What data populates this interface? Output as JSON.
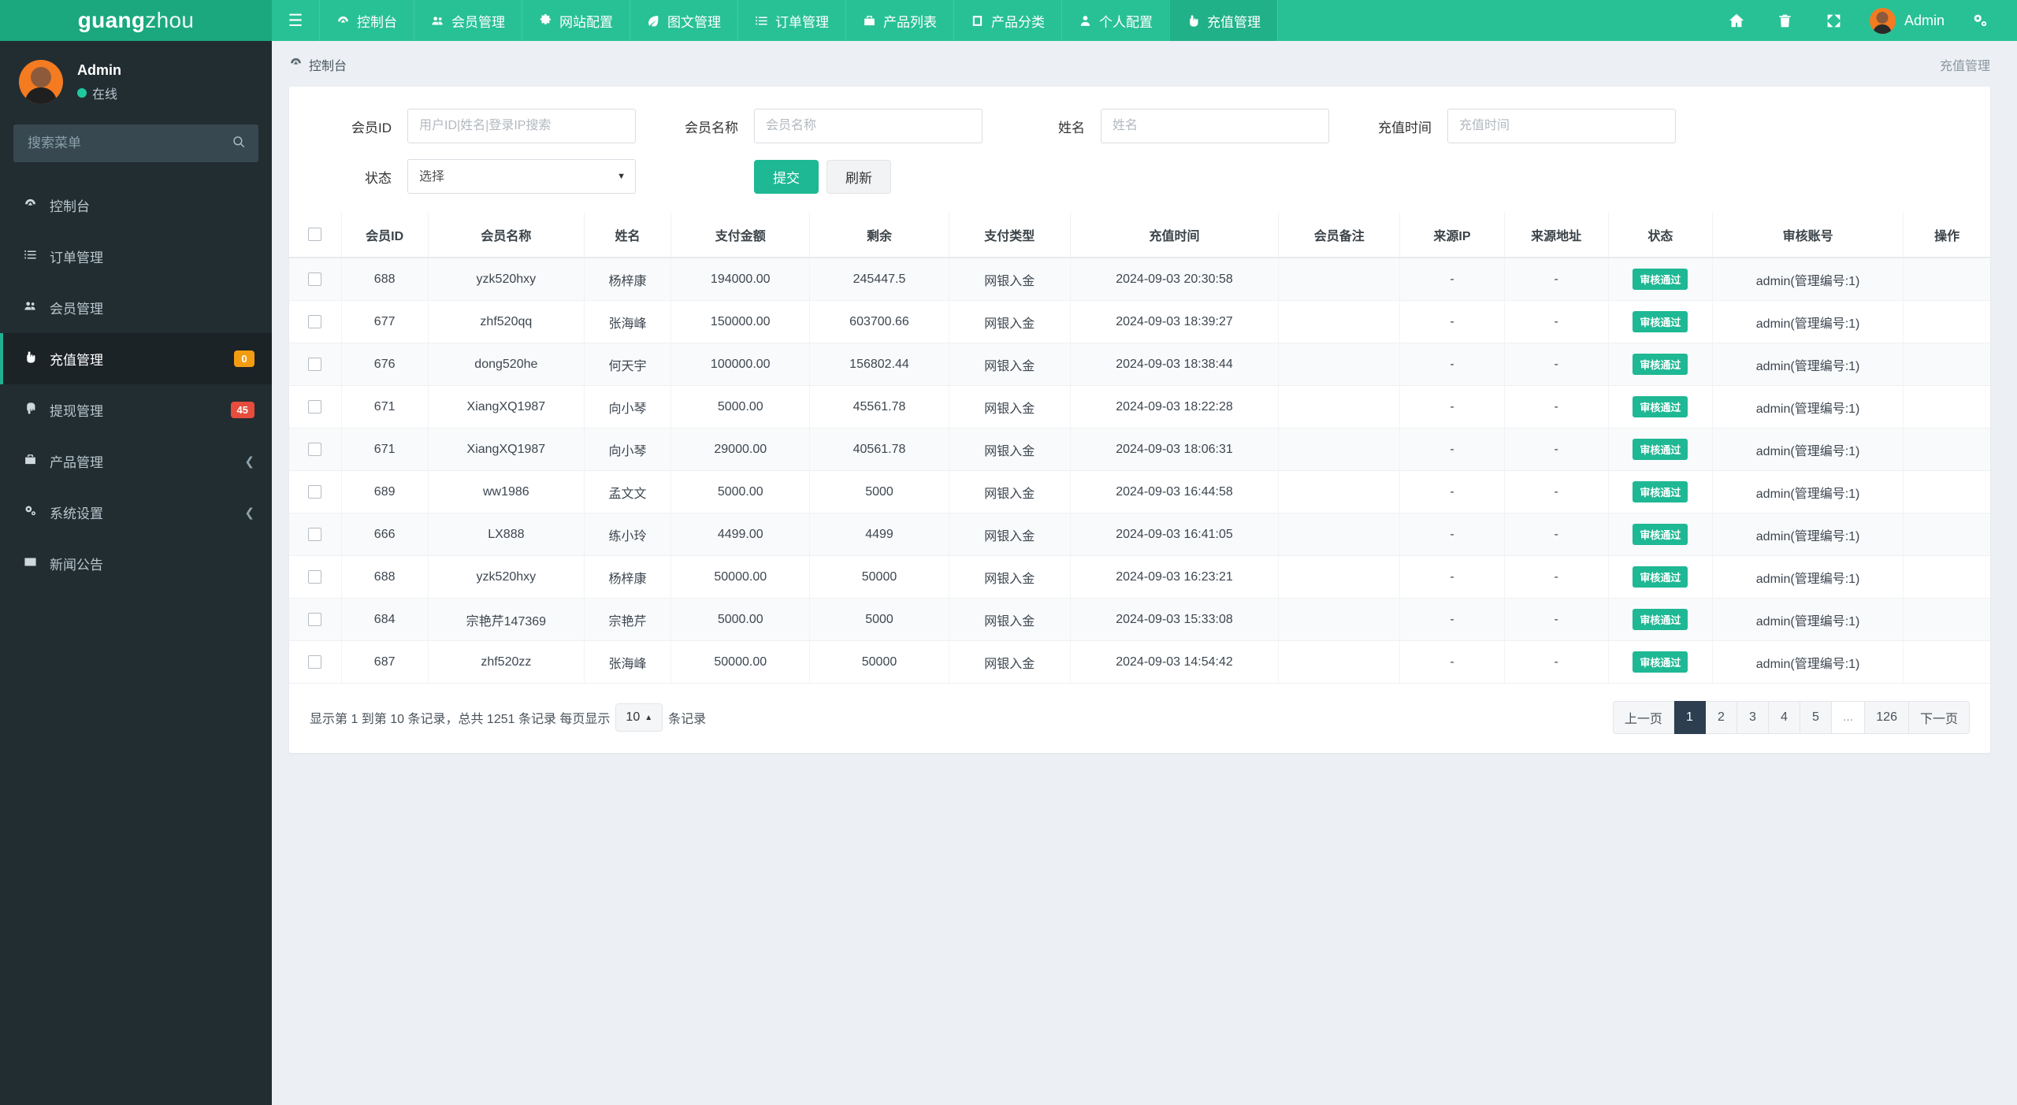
{
  "brand": {
    "bold": "guang",
    "light": "zhou"
  },
  "topnav": {
    "toggle_icon": "hamburger-icon",
    "items": [
      {
        "label": "控制台",
        "icon": "dashboard-icon",
        "active": false
      },
      {
        "label": "会员管理",
        "icon": "users-icon",
        "active": false
      },
      {
        "label": "网站配置",
        "icon": "gear-icon",
        "active": false
      },
      {
        "label": "图文管理",
        "icon": "leaf-icon",
        "active": false
      },
      {
        "label": "订单管理",
        "icon": "list-ol-icon",
        "active": false
      },
      {
        "label": "产品列表",
        "icon": "briefcase-icon",
        "active": false
      },
      {
        "label": "产品分类",
        "icon": "book-icon",
        "active": false
      },
      {
        "label": "个人配置",
        "icon": "user-icon",
        "active": false
      },
      {
        "label": "充值管理",
        "icon": "hand-up-icon",
        "active": true
      }
    ],
    "right_icons": [
      "home-icon",
      "trash-icon",
      "expand-icon"
    ],
    "user_name": "Admin",
    "settings_icon": "gears-icon"
  },
  "sidebar": {
    "user": {
      "name": "Admin",
      "status": "在线"
    },
    "search_placeholder": "搜索菜单",
    "search_value": "",
    "search_icon": "search-icon",
    "items": [
      {
        "label": "控制台",
        "icon": "dashboard-icon",
        "active": false,
        "badge": null,
        "badge_color": null,
        "chevron": false
      },
      {
        "label": "订单管理",
        "icon": "list-ol-icon",
        "active": false,
        "badge": null,
        "badge_color": null,
        "chevron": false
      },
      {
        "label": "会员管理",
        "icon": "users-icon",
        "active": false,
        "badge": null,
        "badge_color": null,
        "chevron": false
      },
      {
        "label": "充值管理",
        "icon": "hand-up-icon",
        "active": true,
        "badge": "0",
        "badge_color": "orange",
        "chevron": false
      },
      {
        "label": "提现管理",
        "icon": "hand-down-icon",
        "active": false,
        "badge": "45",
        "badge_color": "red",
        "chevron": false
      },
      {
        "label": "产品管理",
        "icon": "briefcase-icon",
        "active": false,
        "badge": null,
        "badge_color": null,
        "chevron": true
      },
      {
        "label": "系统设置",
        "icon": "gears-icon",
        "active": false,
        "badge": null,
        "badge_color": null,
        "chevron": true
      },
      {
        "label": "新闻公告",
        "icon": "newspaper-icon",
        "active": false,
        "badge": null,
        "badge_color": null,
        "chevron": false
      }
    ]
  },
  "page": {
    "breadcrumb": "控制台",
    "breadcrumb_icon": "dashboard-icon",
    "right_title": "充值管理"
  },
  "filter": {
    "member_id_label": "会员ID",
    "member_id_placeholder": "用户ID|姓名|登录IP搜索",
    "member_id_value": "",
    "member_name_label": "会员名称",
    "member_name_placeholder": "会员名称",
    "member_name_value": "",
    "real_name_label": "姓名",
    "real_name_placeholder": "姓名",
    "real_name_value": "",
    "recharge_time_label": "充值时间",
    "recharge_time_placeholder": "充值时间",
    "recharge_time_value": "",
    "status_label": "状态",
    "status_selected": "选择",
    "status_options": [
      "选择"
    ],
    "submit_label": "提交",
    "refresh_label": "刷新"
  },
  "table": {
    "columns": [
      "",
      "会员ID",
      "会员名称",
      "姓名",
      "支付金额",
      "剩余",
      "支付类型",
      "充值时间",
      "会员备注",
      "来源IP",
      "来源地址",
      "状态",
      "审核账号",
      "操作"
    ],
    "rows": [
      {
        "member_id": "688",
        "member_name": "yzk520hxy",
        "real_name": "杨梓康",
        "amount": "194000.00",
        "balance": "245447.5",
        "pay_type": "网银入金",
        "time": "2024-09-03 20:30:58",
        "remark": "",
        "src_ip": "-",
        "src_addr": "-",
        "status": "审核通过",
        "auditor": "admin(管理编号:1)",
        "action": ""
      },
      {
        "member_id": "677",
        "member_name": "zhf520qq",
        "real_name": "张海峰",
        "amount": "150000.00",
        "balance": "603700.66",
        "pay_type": "网银入金",
        "time": "2024-09-03 18:39:27",
        "remark": "",
        "src_ip": "-",
        "src_addr": "-",
        "status": "审核通过",
        "auditor": "admin(管理编号:1)",
        "action": ""
      },
      {
        "member_id": "676",
        "member_name": "dong520he",
        "real_name": "何天宇",
        "amount": "100000.00",
        "balance": "156802.44",
        "pay_type": "网银入金",
        "time": "2024-09-03 18:38:44",
        "remark": "",
        "src_ip": "-",
        "src_addr": "-",
        "status": "审核通过",
        "auditor": "admin(管理编号:1)",
        "action": ""
      },
      {
        "member_id": "671",
        "member_name": "XiangXQ1987",
        "real_name": "向小琴",
        "amount": "5000.00",
        "balance": "45561.78",
        "pay_type": "网银入金",
        "time": "2024-09-03 18:22:28",
        "remark": "",
        "src_ip": "-",
        "src_addr": "-",
        "status": "审核通过",
        "auditor": "admin(管理编号:1)",
        "action": ""
      },
      {
        "member_id": "671",
        "member_name": "XiangXQ1987",
        "real_name": "向小琴",
        "amount": "29000.00",
        "balance": "40561.78",
        "pay_type": "网银入金",
        "time": "2024-09-03 18:06:31",
        "remark": "",
        "src_ip": "-",
        "src_addr": "-",
        "status": "审核通过",
        "auditor": "admin(管理编号:1)",
        "action": ""
      },
      {
        "member_id": "689",
        "member_name": "ww1986",
        "real_name": "孟文文",
        "amount": "5000.00",
        "balance": "5000",
        "pay_type": "网银入金",
        "time": "2024-09-03 16:44:58",
        "remark": "",
        "src_ip": "-",
        "src_addr": "-",
        "status": "审核通过",
        "auditor": "admin(管理编号:1)",
        "action": ""
      },
      {
        "member_id": "666",
        "member_name": "LX888",
        "real_name": "练小玲",
        "amount": "4499.00",
        "balance": "4499",
        "pay_type": "网银入金",
        "time": "2024-09-03 16:41:05",
        "remark": "",
        "src_ip": "-",
        "src_addr": "-",
        "status": "审核通过",
        "auditor": "admin(管理编号:1)",
        "action": ""
      },
      {
        "member_id": "688",
        "member_name": "yzk520hxy",
        "real_name": "杨梓康",
        "amount": "50000.00",
        "balance": "50000",
        "pay_type": "网银入金",
        "time": "2024-09-03 16:23:21",
        "remark": "",
        "src_ip": "-",
        "src_addr": "-",
        "status": "审核通过",
        "auditor": "admin(管理编号:1)",
        "action": ""
      },
      {
        "member_id": "684",
        "member_name": "宗艳芹147369",
        "real_name": "宗艳芹",
        "amount": "5000.00",
        "balance": "5000",
        "pay_type": "网银入金",
        "time": "2024-09-03 15:33:08",
        "remark": "",
        "src_ip": "-",
        "src_addr": "-",
        "status": "审核通过",
        "auditor": "admin(管理编号:1)",
        "action": ""
      },
      {
        "member_id": "687",
        "member_name": "zhf520zz",
        "real_name": "张海峰",
        "amount": "50000.00",
        "balance": "50000",
        "pay_type": "网银入金",
        "time": "2024-09-03 14:54:42",
        "remark": "",
        "src_ip": "-",
        "src_addr": "-",
        "status": "审核通过",
        "auditor": "admin(管理编号:1)",
        "action": ""
      }
    ]
  },
  "footer": {
    "summary_prefix": "显示第 1 到第 10 条记录，总共 1251 条记录 每页显示",
    "per_page": "10",
    "summary_suffix": "条记录",
    "pager": [
      {
        "label": "上一页",
        "active": false,
        "kind": "prev"
      },
      {
        "label": "1",
        "active": true,
        "kind": "num"
      },
      {
        "label": "2",
        "active": false,
        "kind": "num"
      },
      {
        "label": "3",
        "active": false,
        "kind": "num"
      },
      {
        "label": "4",
        "active": false,
        "kind": "num"
      },
      {
        "label": "5",
        "active": false,
        "kind": "num"
      },
      {
        "label": "...",
        "active": false,
        "kind": "ellipsis"
      },
      {
        "label": "126",
        "active": false,
        "kind": "num"
      },
      {
        "label": "下一页",
        "active": false,
        "kind": "next"
      }
    ]
  },
  "colors": {
    "brand_green": "#1ba87e",
    "nav_green": "#28c196",
    "accent": "#1eb894",
    "sidebar_dark": "#222d32",
    "badge_orange": "#f39c12",
    "badge_red": "#e74c3c",
    "pager_active": "#2c3e50"
  }
}
